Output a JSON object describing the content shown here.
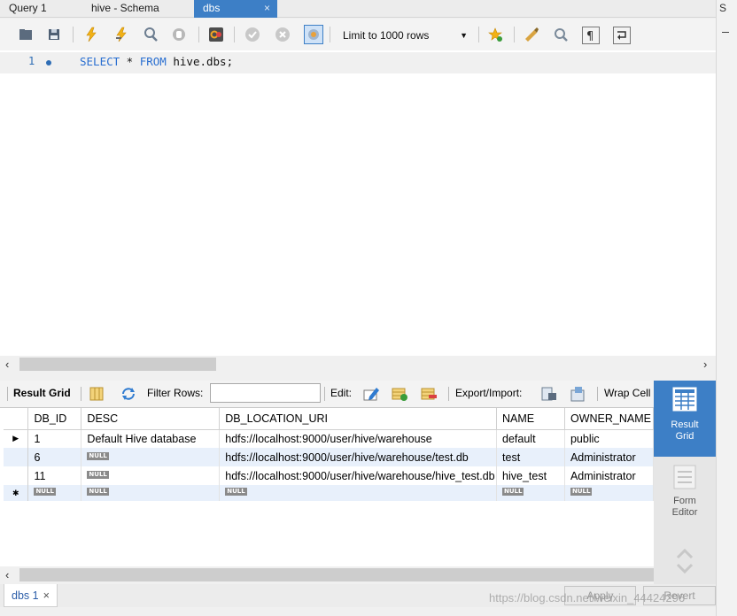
{
  "tabs": [
    {
      "label": "Query 1",
      "active": false
    },
    {
      "label": "hive - Schema",
      "active": false
    },
    {
      "label": "dbs",
      "active": true,
      "close": "×"
    }
  ],
  "side_panel_letter": "S",
  "toolbar": {
    "icons": [
      "open-folder-icon",
      "save-icon",
      "execute-icon",
      "execute-current-icon",
      "explain-icon",
      "stop-icon",
      "toggle-error-icon",
      "commit-icon",
      "rollback-icon",
      "autocommit-icon",
      "beautify-icon",
      "find-icon",
      "invisible-chars-icon",
      "word-wrap-icon",
      "bookmark-icon"
    ],
    "limit_label": "Limit to 1000 rows"
  },
  "editor": {
    "line_number": "1",
    "keyword_select": "SELECT",
    "star": " * ",
    "keyword_from": "FROM",
    "rest": " hive.dbs;"
  },
  "results_toolbar": {
    "result_grid_label": "Result Grid",
    "filter_label": "Filter Rows:",
    "filter_value": "",
    "edit_label": "Edit:",
    "export_label": "Export/Import:",
    "wrap_label": "Wrap Cell Content:"
  },
  "grid": {
    "columns": [
      "DB_ID",
      "DESC",
      "DB_LOCATION_URI",
      "NAME",
      "OWNER_NAME"
    ],
    "rows": [
      [
        "1",
        "Default Hive database",
        "hdfs://localhost:9000/user/hive/warehouse",
        "default",
        "public"
      ],
      [
        "6",
        "NULL",
        "hdfs://localhost:9000/user/hive/warehouse/test.db",
        "test",
        "Administrator"
      ],
      [
        "11",
        "NULL",
        "hdfs://localhost:9000/user/hive/warehouse/hive_test.db",
        "hive_test",
        "Administrator"
      ]
    ],
    "null_label": "NULL"
  },
  "right_panel": {
    "result_grid": "Result Grid",
    "form_editor": "Form Editor"
  },
  "bottom": {
    "tab_label": "dbs 1",
    "tab_close": "×",
    "apply_label": "Apply",
    "revert_label": "Revert",
    "watermark": "https://blog.csdn.net/weixin_44424296"
  },
  "colors": {
    "accent": "#3d7fc6",
    "keyword": "#2a6fd1",
    "row_alt": "#e8f0fb"
  }
}
